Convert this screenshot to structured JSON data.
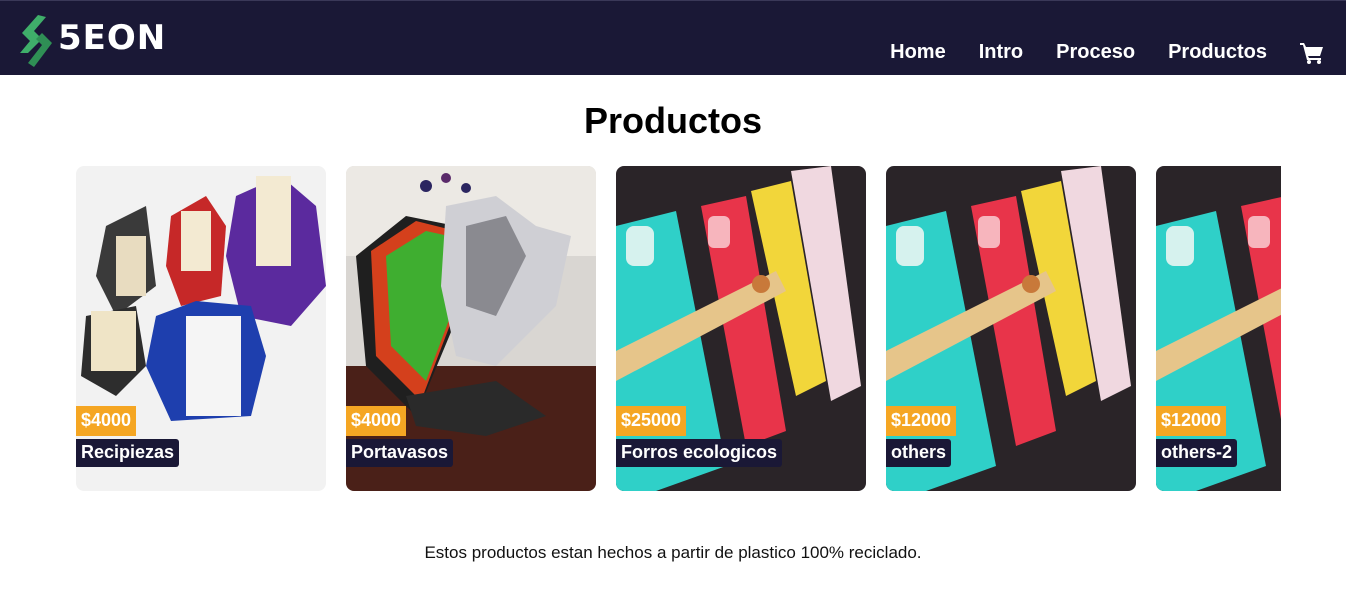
{
  "header": {
    "logo_text": "5EON",
    "nav": [
      "Home",
      "Intro",
      "Proceso",
      "Productos"
    ],
    "cart_icon": "cart-icon"
  },
  "main": {
    "title": "Productos",
    "products": [
      {
        "price": "$4000",
        "name": "Recipiezas"
      },
      {
        "price": "$4000",
        "name": "Portavasos"
      },
      {
        "price": "$25000",
        "name": "Forros ecologicos"
      },
      {
        "price": "$12000",
        "name": "others"
      },
      {
        "price": "$12000",
        "name": "others-2"
      }
    ],
    "footer_text": "Estos productos estan hechos a partir de plastico 100% reciclado."
  },
  "colors": {
    "navbar_bg": "#1a1836",
    "price_badge": "#f5a623",
    "name_badge": "#1a1836",
    "logo_green": "#3fae6a"
  }
}
